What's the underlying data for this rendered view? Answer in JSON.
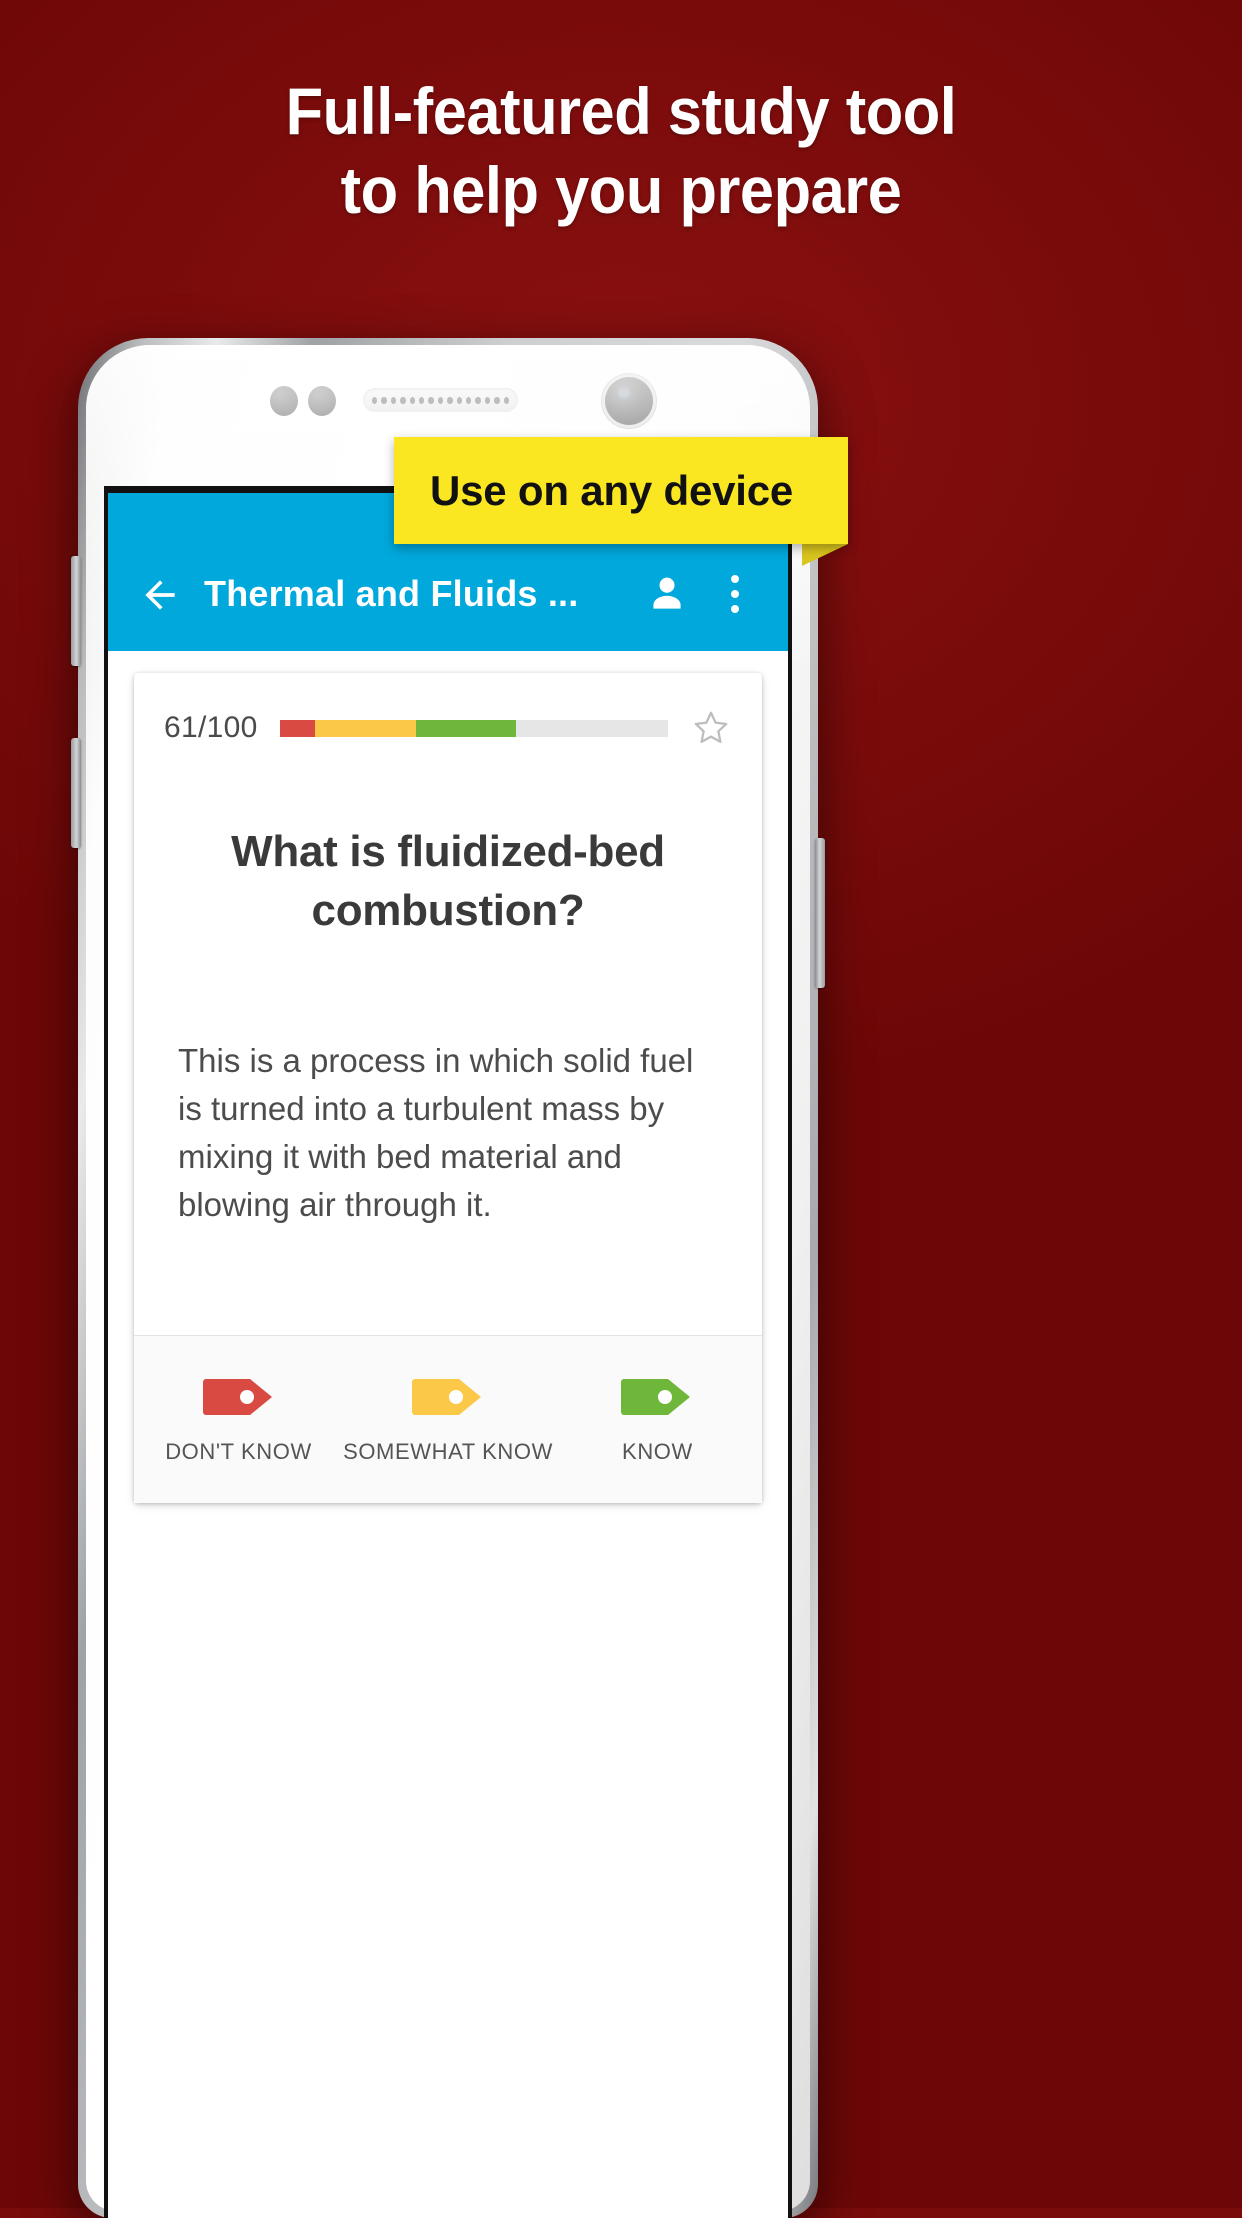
{
  "page": {
    "background_color": "#7a0b0b",
    "headline_lines": [
      "Full-featured study tool",
      "to help you prepare"
    ]
  },
  "callout": {
    "label": "Use on any device",
    "background_color": "#fbe622",
    "text_color": "#111111"
  },
  "app": {
    "appbar": {
      "background_color": "#00a8db",
      "title": "Thermal and Fluids ...",
      "back_icon": "back-arrow-icon",
      "account_icon": "person-icon",
      "overflow_icon": "more-vert-icon"
    },
    "card": {
      "progress": {
        "count_label": "61/100",
        "current": 61,
        "total": 100,
        "segments": [
          {
            "name": "dont-know",
            "color": "#d94a43",
            "percent": 9
          },
          {
            "name": "somewhat-know",
            "color": "#fbc848",
            "percent": 26
          },
          {
            "name": "know",
            "color": "#6fb73a",
            "percent": 26
          },
          {
            "name": "unseen",
            "color": "#e6e6e6",
            "percent": 39
          }
        ],
        "star_icon": "star-outline-icon",
        "starred": false
      },
      "question": "What is fluidized-bed combustion?",
      "answer": "This is a process in which solid fuel is turned into a turbulent mass by mixing it with bed material and blowing air through it."
    },
    "rating_buttons": [
      {
        "name": "dont-know",
        "label": "DON'T KNOW",
        "color": "#d94a43",
        "icon": "tag-arrow-icon"
      },
      {
        "name": "somewhat-know",
        "label": "SOMEWHAT KNOW",
        "color": "#fbc848",
        "icon": "tag-arrow-icon"
      },
      {
        "name": "know",
        "label": "KNOW",
        "color": "#6fb73a",
        "icon": "tag-arrow-icon"
      }
    ]
  }
}
